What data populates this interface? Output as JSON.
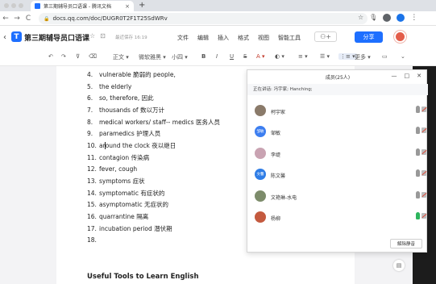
{
  "browser": {
    "tab_title": "第三期辅导员口语课 - 腾讯文档",
    "tab_close": "×",
    "new_tab": "+",
    "url": "docs.qq.com/doc/DUGR0T2F1T25SdWRv",
    "nav": {
      "back": "←",
      "forward": "→",
      "reload": "C"
    },
    "icons": [
      "star-icon",
      "microphone-icon",
      "profile-icon",
      "extension-icon",
      "menu-icon"
    ]
  },
  "doc_header": {
    "back": "‹",
    "logo": "T",
    "title": "第三期辅导员口语课",
    "title_icons": [
      "☆",
      "⊡"
    ],
    "save_status": "最近保存 16:19",
    "menus": [
      "文件",
      "编辑",
      "插入",
      "格式",
      "视图",
      "智能工具"
    ],
    "collab_label": "+",
    "share_label": "分享"
  },
  "toolbar": {
    "undo": "↶",
    "redo": "↷",
    "format_painter": "⊽",
    "clear_format": "⌫",
    "style": "正文 ▾",
    "font": "微软雅黑 ▾",
    "size": "小四 ▾",
    "bold": "B",
    "italic": "I",
    "underline": "U",
    "strike": "S",
    "font_color": "A ▾",
    "highlight": "◐ ▾",
    "align": "≡ ▾",
    "list": "☰ ▾",
    "numbered_list": "⋮≡ ▾",
    "more": "更多 ▾",
    "comment": "▭",
    "expand": "⌄"
  },
  "document": {
    "items": [
      {
        "num": "4.",
        "text": "vulnerable 脆弱的 people,"
      },
      {
        "num": "5.",
        "text": "the elderly"
      },
      {
        "num": "6.",
        "text": "so, therefore, 因此"
      },
      {
        "num": "7.",
        "text": "thousands of 数以万计"
      },
      {
        "num": "8.",
        "text": "medical workers/ staff-- medics 医务人员"
      },
      {
        "num": "9.",
        "text": "paramedics 护理人员"
      },
      {
        "num": "10.",
        "text_before_caret": "ar",
        "text_after_caret": "ound the clock 夜以继日"
      },
      {
        "num": "11.",
        "text": "contagion 传染病"
      },
      {
        "num": "12.",
        "text": "fever, cough"
      },
      {
        "num": "13.",
        "text": "symptoms 症状"
      },
      {
        "num": "14.",
        "text": "symptomatic 有症状的"
      },
      {
        "num": "15.",
        "text": "asymptomatic 无症状的"
      },
      {
        "num": "16.",
        "text": "quarrantine 隔离"
      },
      {
        "num": "17.",
        "text": "incubation period 潜伏期"
      },
      {
        "num": "18.",
        "text": ""
      }
    ],
    "section_title": "Useful Tools to Learn English"
  },
  "members_panel": {
    "title": "成员(25人)",
    "ctrl_min": "—",
    "ctrl_max": "□",
    "ctrl_close": "✕",
    "speaking": "正在讲话: 冯宇家; Hanching;",
    "members": [
      {
        "name": "柯宇家",
        "avatar_text": "",
        "avatar_color": "#8a7a6a",
        "mic_on": false
      },
      {
        "name": "邹敏",
        "avatar_text": "邹敏",
        "avatar_color": "#3d7ef0",
        "mic_on": false
      },
      {
        "name": "李缇",
        "avatar_text": "",
        "avatar_color": "#c9a3b2",
        "mic_on": false
      },
      {
        "name": "陈文馨",
        "avatar_text": "文馨",
        "avatar_color": "#2f7de6",
        "mic_on": false
      },
      {
        "name": "文艳琳-水电",
        "avatar_text": "",
        "avatar_color": "#7d8c6b",
        "mic_on": false
      },
      {
        "name": "杨柳",
        "avatar_text": "",
        "avatar_color": "#c45a3f",
        "mic_on": true
      }
    ],
    "unmute_label": "解除静音"
  },
  "side_icon": "▤",
  "colors": {
    "brand": "#1e6fff",
    "mic_on": "#2db55d",
    "cam_off": "#e04a3a"
  }
}
